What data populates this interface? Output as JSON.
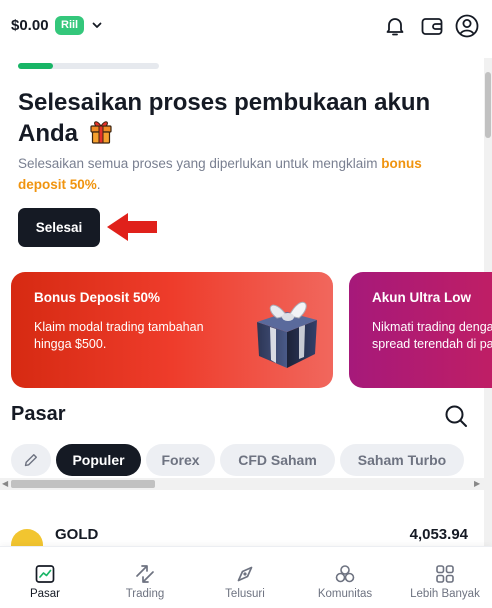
{
  "header": {
    "balance": "$0.00",
    "account_type": "Riil",
    "icons": [
      "chevron-down-icon",
      "bell-icon",
      "wallet-icon",
      "user-icon"
    ]
  },
  "onboarding": {
    "progress": 0.25,
    "title": "Selesaikan proses pembukaan akun Anda",
    "description": "Selesaikan semua proses yang diperlukan untuk mengklaim",
    "highlight": "bonus deposit 50%",
    "highlight_suffix": ".",
    "button_label": "Selesai"
  },
  "promos": [
    {
      "title": "Bonus Deposit 50%",
      "description": "Klaim modal trading tambahan hingga $500.",
      "color": "#e7321f"
    },
    {
      "title": "Akun Ultra Low",
      "description": "Nikmati trading dengan spread terendah di pasar.",
      "color": "#b61b70"
    }
  ],
  "market": {
    "title": "Pasar",
    "chips": [
      "Populer",
      "Forex",
      "CFD Saham",
      "Saham Turbo"
    ],
    "active_chip": "Populer",
    "rows": [
      {
        "symbol": "GOLD",
        "price": "4,053.94"
      }
    ]
  },
  "nav": {
    "items": [
      {
        "label": "Pasar",
        "icon": "chart-icon",
        "active": true
      },
      {
        "label": "Trading",
        "icon": "trade-arrows-icon",
        "active": false
      },
      {
        "label": "Telusuri",
        "icon": "compass-icon",
        "active": false
      },
      {
        "label": "Komunitas",
        "icon": "community-icon",
        "active": false
      },
      {
        "label": "Lebih Banyak",
        "icon": "grid-icon",
        "active": false
      }
    ]
  },
  "colors": {
    "primary_dark": "#151a24",
    "accent_green": "#34c77b",
    "highlight_orange": "#f0940f",
    "arrow_red": "#e0211b"
  }
}
